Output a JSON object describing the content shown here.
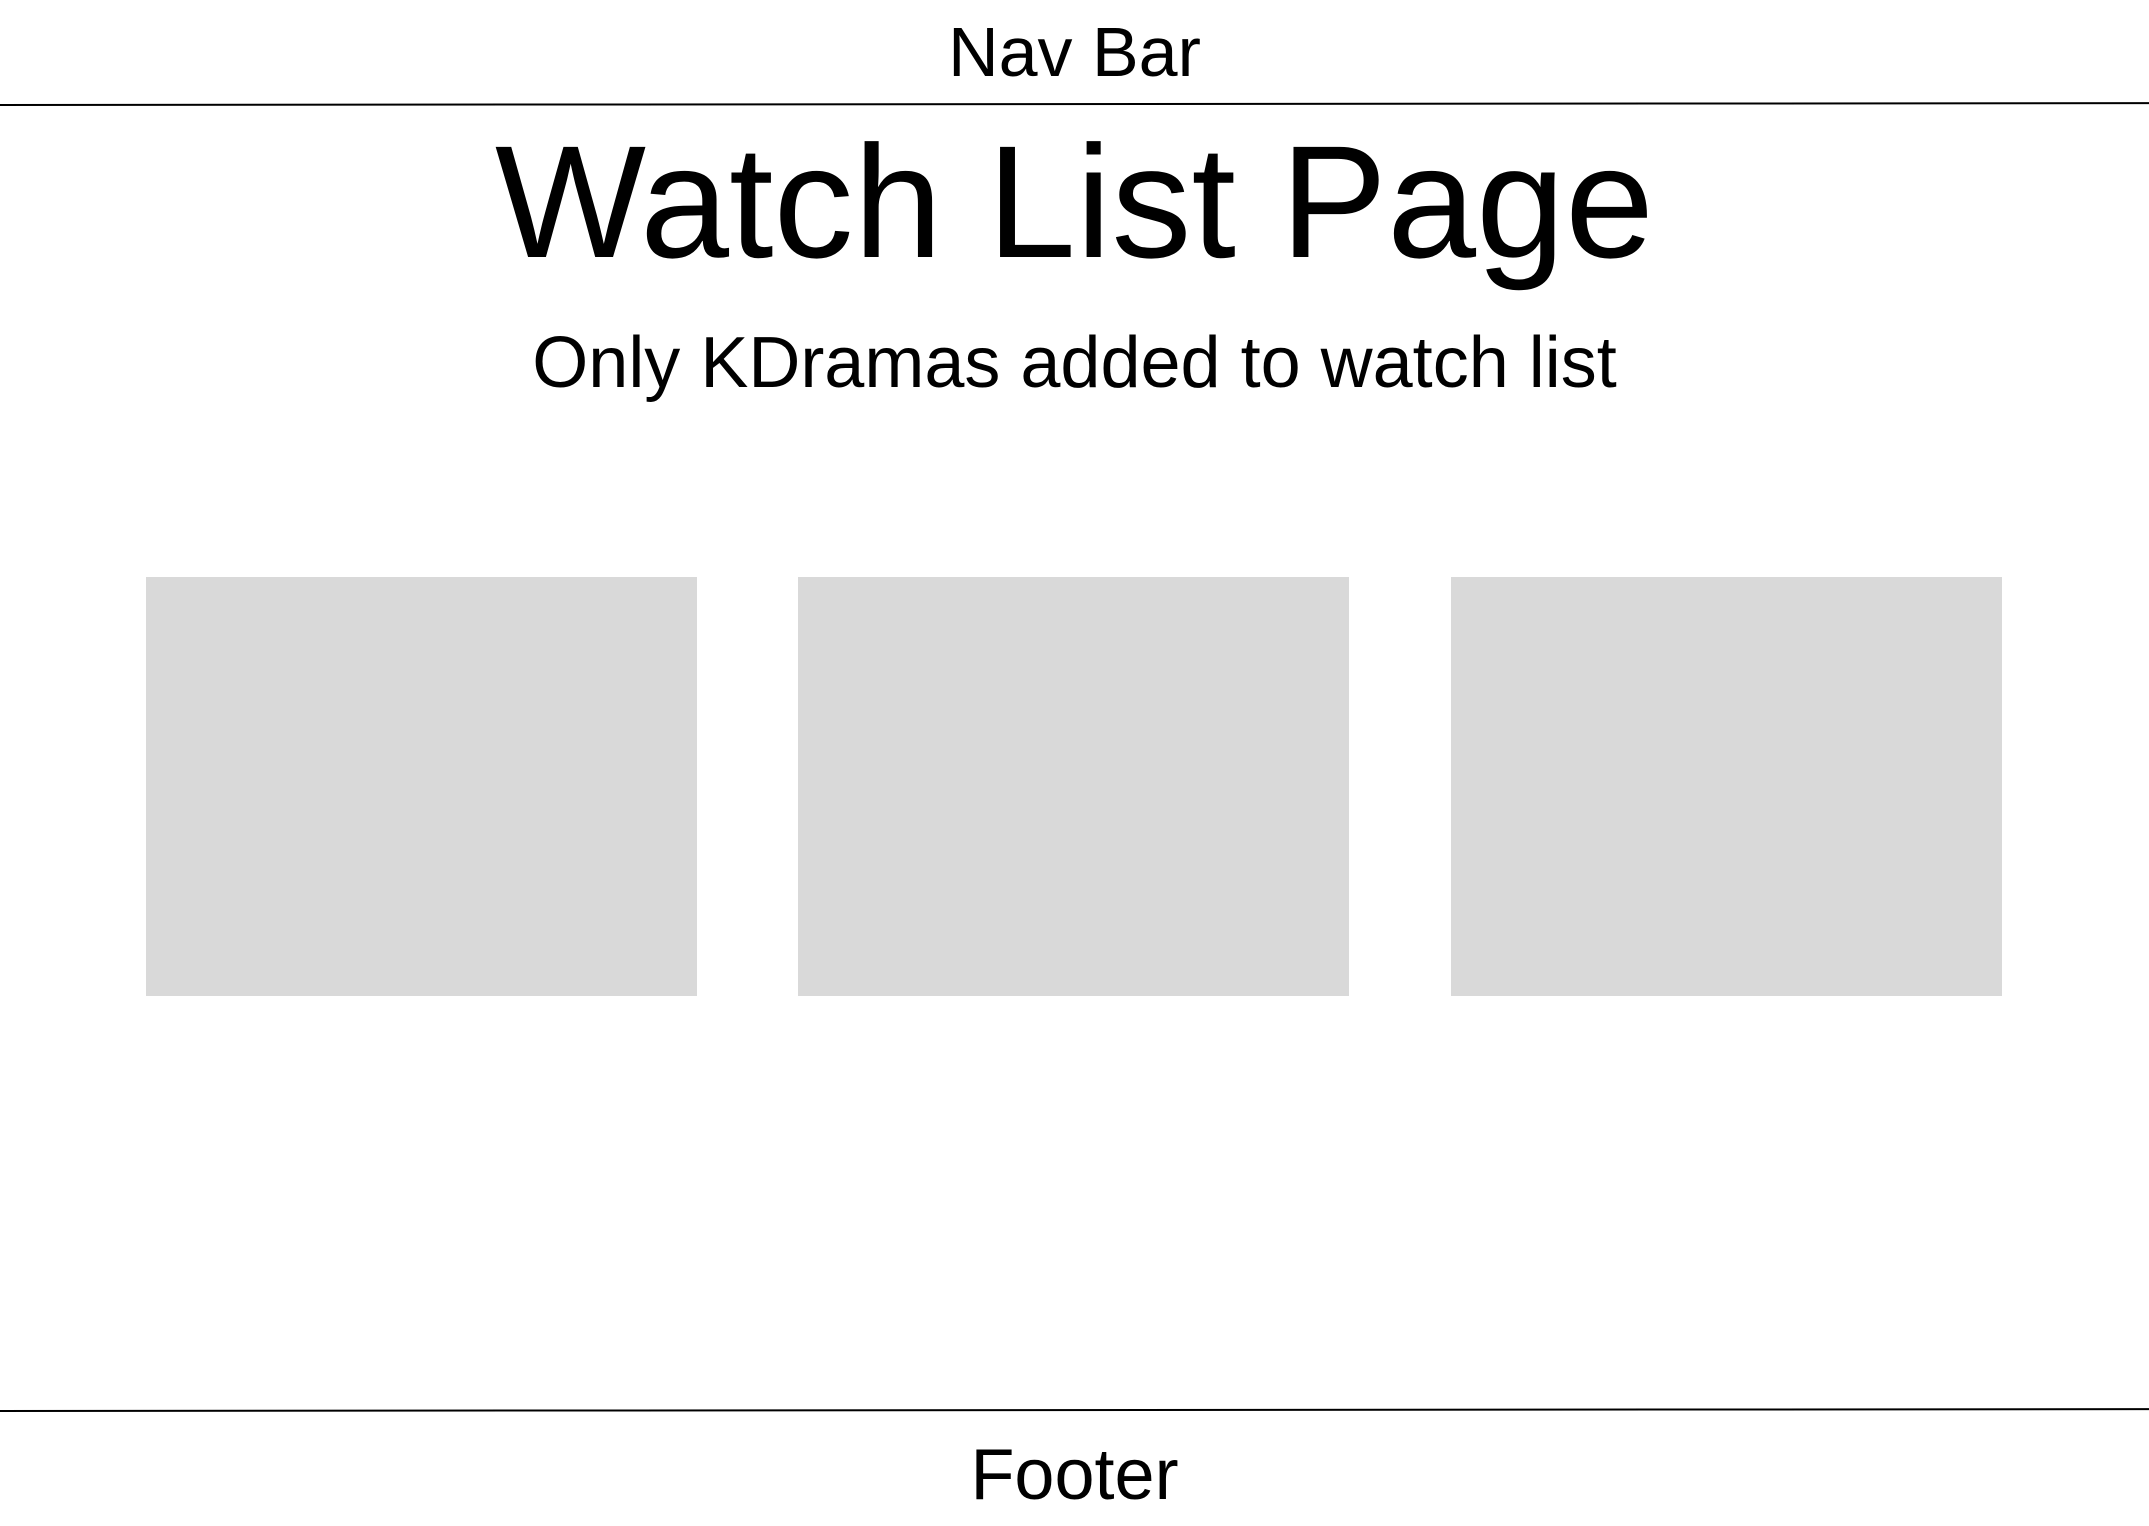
{
  "nav": {
    "label": "Nav Bar"
  },
  "main": {
    "title": "Watch List Page",
    "subtitle": "Only KDramas added to watch list",
    "cards": [
      {
        "color": "#d9d9d9"
      },
      {
        "color": "#d9d9d9"
      },
      {
        "color": "#d9d9d9"
      }
    ]
  },
  "footer": {
    "label": "Footer"
  }
}
